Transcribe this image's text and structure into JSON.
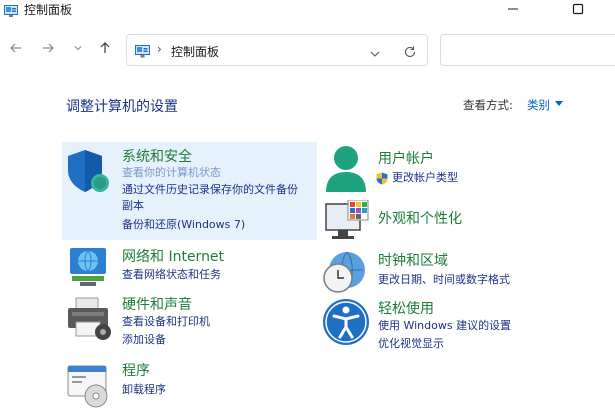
{
  "window": {
    "title": "控制面板",
    "minimize_icon": "minimize-icon",
    "maximize_icon": "maximize-icon"
  },
  "address_bar": {
    "breadcrumb": "控制面板",
    "search_placeholder": ""
  },
  "page": {
    "heading": "调整计算机的设置",
    "view_by_label": "查看方式:",
    "view_by_value": "类别"
  },
  "categories": {
    "system": {
      "title": "系统和安全",
      "links": [
        "查看你的计算机状态",
        "通过文件历史记录保存你的文件备份",
        "副本",
        "备份和还原(Windows 7)"
      ]
    },
    "network": {
      "title": "网络和 Internet",
      "links": [
        "查看网络状态和任务"
      ]
    },
    "hardware": {
      "title": "硬件和声音",
      "links": [
        "查看设备和打印机",
        "添加设备"
      ]
    },
    "programs": {
      "title": "程序",
      "links": [
        "卸载程序"
      ]
    },
    "accounts": {
      "title": "用户帐户",
      "links": [
        "更改帐户类型"
      ]
    },
    "appearance": {
      "title": "外观和个性化",
      "links": []
    },
    "clock": {
      "title": "时钟和区域",
      "links": [
        "更改日期、时间或数字格式"
      ]
    },
    "ease": {
      "title": "轻松使用",
      "links": [
        "使用 Windows 建议的设置",
        "优化视觉显示"
      ]
    }
  },
  "colors": {
    "accent": "#0066cc",
    "category_title": "#1e7d3a",
    "link": "#1e3287",
    "selected_bg": "#e5f1fb"
  }
}
